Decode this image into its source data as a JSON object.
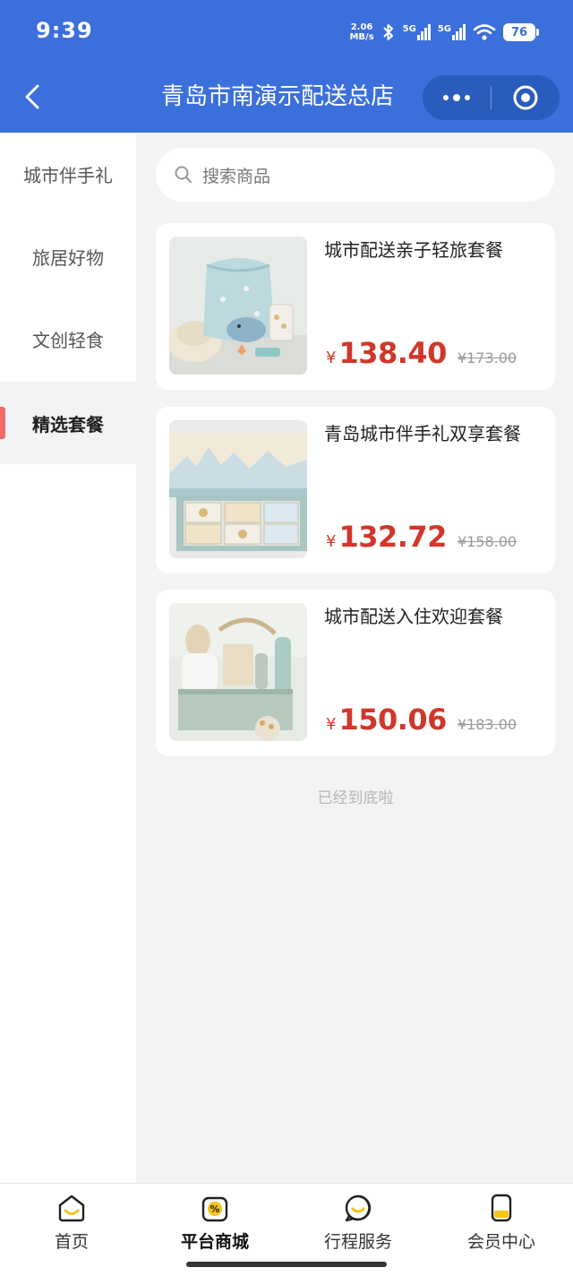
{
  "status_bar": {
    "time": "9:39",
    "net_speed_value": "2.06",
    "net_speed_unit": "MB/s",
    "signal_1": "5G",
    "signal_2": "5G",
    "battery": "76"
  },
  "navbar": {
    "title": "青岛市南演示配送总店"
  },
  "sidebar": {
    "items": [
      {
        "label": "城市伴手礼",
        "active": false
      },
      {
        "label": "旅居好物",
        "active": false
      },
      {
        "label": "文创轻食",
        "active": false
      },
      {
        "label": "精选套餐",
        "active": true
      }
    ]
  },
  "search": {
    "placeholder": "搜索商品"
  },
  "products": [
    {
      "title": "城市配送亲子轻旅套餐",
      "currency": "¥",
      "price": "138.40",
      "original_price": "¥173.00"
    },
    {
      "title": "青岛城市伴手礼双享套餐",
      "currency": "¥",
      "price": "132.72",
      "original_price": "¥158.00"
    },
    {
      "title": "城市配送入住欢迎套餐",
      "currency": "¥",
      "price": "150.06",
      "original_price": "¥183.00"
    }
  ],
  "end_note": "已经到底啦",
  "tabbar": {
    "items": [
      {
        "label": "首页",
        "icon": "home-icon"
      },
      {
        "label": "平台商城",
        "icon": "shop-icon",
        "active": true
      },
      {
        "label": "行程服务",
        "icon": "service-icon"
      },
      {
        "label": "会员中心",
        "icon": "member-icon"
      }
    ]
  },
  "colors": {
    "header": "#3b6fdc",
    "price": "#d1362a",
    "active_marker": "#f26a6a",
    "icon_accent": "#f5c518"
  }
}
